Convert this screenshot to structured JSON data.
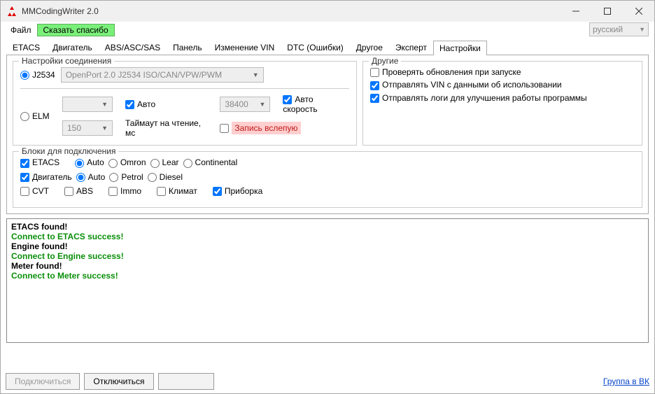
{
  "window": {
    "title": "MMCodingWriter 2.0"
  },
  "menu": {
    "file": "Файл",
    "thanks": "Сказать спасибо",
    "lang": "русский"
  },
  "tabs": [
    "ETACS",
    "Двигатель",
    "ABS/ASC/SAS",
    "Панель",
    "Изменение VIN",
    "DTC (Ошибки)",
    "Другое",
    "Эксперт",
    "Настройки"
  ],
  "active_tab": 8,
  "conn": {
    "legend": "Настройки соединения",
    "j2534": "J2534",
    "j2534_adapter": "OpenPort 2.0 J2534 ISO/CAN/VPW/PWM",
    "elm": "ELM",
    "auto": "Авто",
    "baud": "38400",
    "auto_speed": "Авто скорость",
    "timeout_val": "150",
    "timeout_lbl": "Таймаут на чтение, мс",
    "blind": "Запись вслепую"
  },
  "other": {
    "legend": "Другие",
    "check_updates": "Проверять обновления при запуске",
    "send_vin": "Отправлять VIN с данными об использовании",
    "send_logs": "Отправлять логи для улучшения работы программы"
  },
  "blocks": {
    "legend": "Блоки для подключения",
    "etacs": "ETACS",
    "auto": "Auto",
    "omron": "Omron",
    "lear": "Lear",
    "continental": "Continental",
    "engine": "Двигатель",
    "petrol": "Petrol",
    "diesel": "Diesel",
    "cvt": "CVT",
    "abs": "ABS",
    "immo": "Immo",
    "climate": "Климат",
    "meter": "Приборка"
  },
  "console": [
    {
      "t": "ETACS found!",
      "c": ""
    },
    {
      "t": "Connect to ETACS success!",
      "c": "ok"
    },
    {
      "t": "Engine found!",
      "c": ""
    },
    {
      "t": "Connect to Engine success!",
      "c": "ok"
    },
    {
      "t": "Meter found!",
      "c": ""
    },
    {
      "t": "Connect to Meter success!",
      "c": "ok"
    }
  ],
  "bottom": {
    "connect": "Подключиться",
    "disconnect": "Отключиться",
    "vk": "Группа в ВК"
  }
}
